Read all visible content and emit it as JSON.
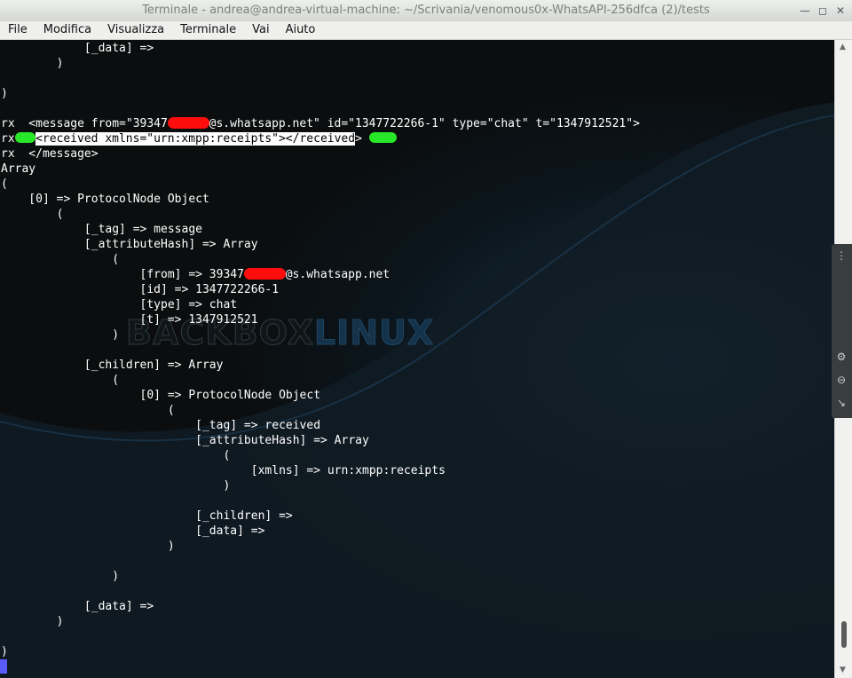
{
  "window": {
    "title": "Terminale - andrea@andrea-virtual-machine: ~/Scrivania/venomous0x-WhatsAPI-256dfca (2)/tests"
  },
  "menu": [
    "File",
    "Modifica",
    "Visualizza",
    "Terminale",
    "Vai",
    "Aiuto"
  ],
  "watermark": {
    "part1": "BACKBOX",
    "part2": "LINUX"
  },
  "terminal_lines": [
    {
      "text": "            [_data] =>"
    },
    {
      "text": "        )"
    },
    {
      "text": ""
    },
    {
      "text": ")"
    },
    {
      "text": ""
    },
    {
      "pre": "rx  <message from=\"39347",
      "redact_ch": 6,
      "post": "@s.whatsapp.net\" id=\"1347722266-1\" type=\"chat\" t=\"1347912521\">"
    },
    {
      "pre": "rx",
      "green1_ch": 3,
      "hl": "<received xmlns=\"urn:xmpp:receipts\"></received",
      "post": "> ",
      "green2_ch": 4
    },
    {
      "text": "rx  </message>"
    },
    {
      "text": "Array"
    },
    {
      "text": "("
    },
    {
      "text": "    [0] => ProtocolNode Object"
    },
    {
      "text": "        ("
    },
    {
      "text": "            [_tag] => message"
    },
    {
      "text": "            [_attributeHash] => Array"
    },
    {
      "text": "                ("
    },
    {
      "pre": "                    [from] => 39347",
      "redact_ch": 6,
      "post": "@s.whatsapp.net"
    },
    {
      "text": "                    [id] => 1347722266-1"
    },
    {
      "text": "                    [type] => chat"
    },
    {
      "text": "                    [t] => 1347912521"
    },
    {
      "text": "                )"
    },
    {
      "text": ""
    },
    {
      "text": "            [_children] => Array"
    },
    {
      "text": "                ("
    },
    {
      "text": "                    [0] => ProtocolNode Object"
    },
    {
      "text": "                        ("
    },
    {
      "text": "                            [_tag] => received"
    },
    {
      "text": "                            [_attributeHash] => Array"
    },
    {
      "text": "                                ("
    },
    {
      "text": "                                    [xmlns] => urn:xmpp:receipts"
    },
    {
      "text": "                                )"
    },
    {
      "text": ""
    },
    {
      "text": "                            [_children] =>"
    },
    {
      "text": "                            [_data] =>"
    },
    {
      "text": "                        )"
    },
    {
      "text": ""
    },
    {
      "text": "                )"
    },
    {
      "text": ""
    },
    {
      "text": "            [_data] =>"
    },
    {
      "text": "        )"
    },
    {
      "text": ""
    },
    {
      "text": ")"
    }
  ],
  "colors": {
    "terminal_bg": "#0b0d0e",
    "terminal_fg": "#ffffff",
    "redaction": "#ff0c0c",
    "highlight_blob": "#28e628",
    "cursor": "#5a5cff"
  }
}
